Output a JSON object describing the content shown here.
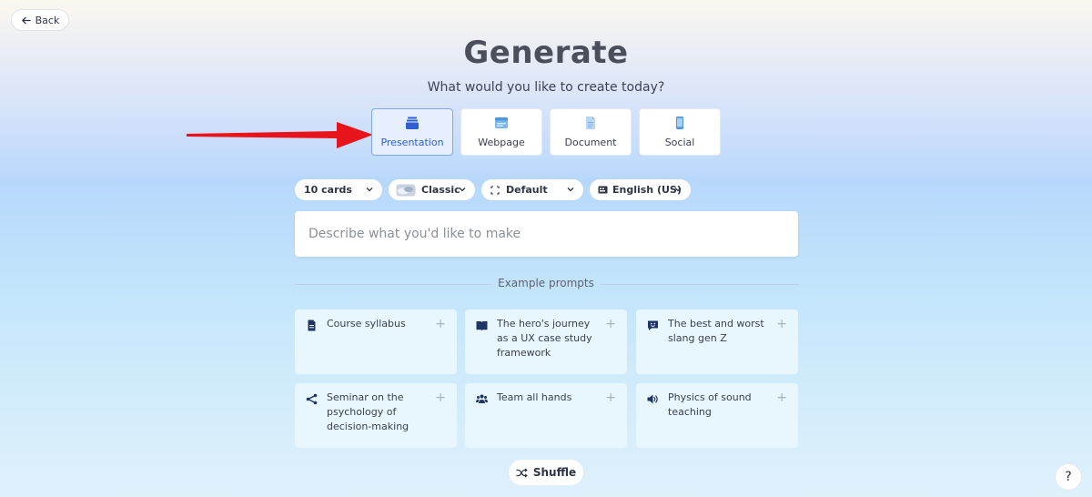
{
  "back": {
    "label": "Back"
  },
  "header": {
    "title": "Generate",
    "subtitle": "What would you like to create today?"
  },
  "types": [
    {
      "label": "Presentation",
      "icon": "stack-icon",
      "selected": true
    },
    {
      "label": "Webpage",
      "icon": "browser-window-icon",
      "selected": false
    },
    {
      "label": "Document",
      "icon": "document-icon",
      "selected": false
    },
    {
      "label": "Social",
      "icon": "phone-icon",
      "selected": false
    }
  ],
  "options": {
    "cards": "10 cards",
    "theme": "Classic",
    "format": "Default",
    "language": "English (US)"
  },
  "prompt": {
    "placeholder": "Describe what you'd like to make"
  },
  "examples": {
    "heading": "Example prompts",
    "items": [
      {
        "text": "Course syllabus",
        "icon": "document-icon"
      },
      {
        "text": "The hero's journey as a UX case study framework",
        "icon": "open-book-icon"
      },
      {
        "text": "The best and worst slang gen Z",
        "icon": "chat-emoji-icon"
      },
      {
        "text": "Seminar on the psychology of decision-making",
        "icon": "share-nodes-icon"
      },
      {
        "text": "Team all hands",
        "icon": "people-icon"
      },
      {
        "text": "Physics of sound teaching",
        "icon": "speaker-icon"
      }
    ]
  },
  "shuffle": {
    "label": "Shuffle"
  },
  "help": {
    "label": "?"
  },
  "colors": {
    "accent": "#2f5fd0",
    "arrow": "#e8141b",
    "icon_dark": "#1f3566"
  }
}
